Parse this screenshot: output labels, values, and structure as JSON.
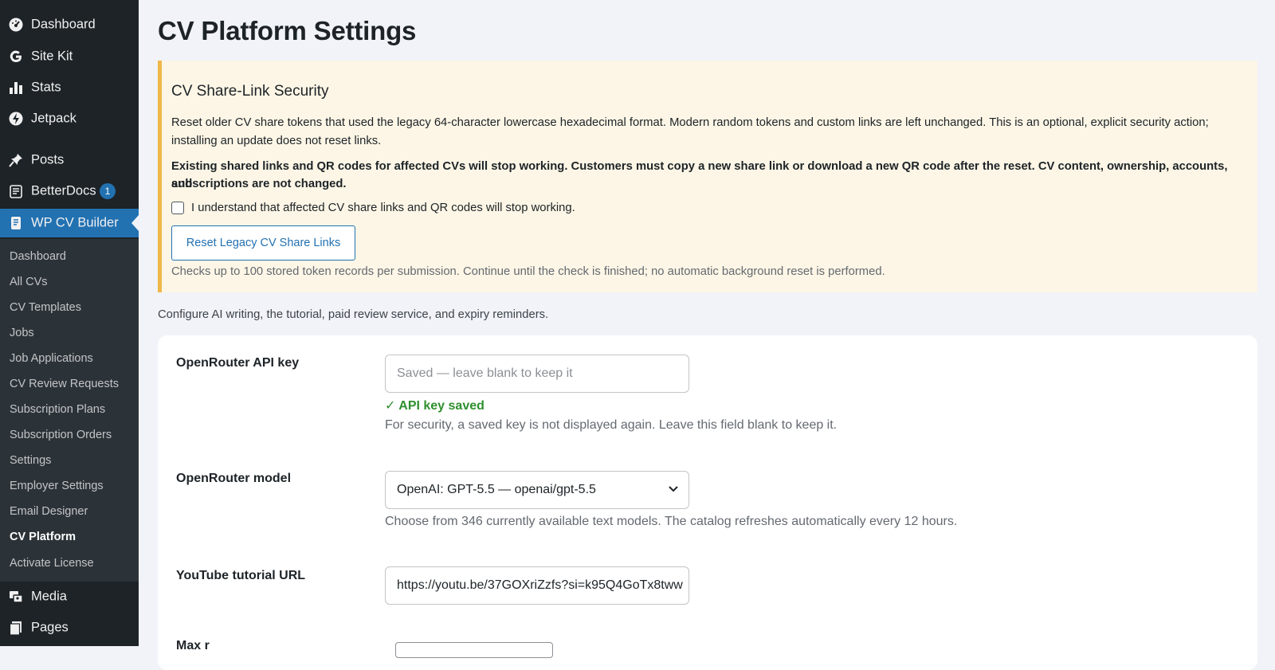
{
  "sidebar": {
    "top_items": [
      {
        "label": "Dashboard",
        "icon": "dashboard-icon"
      },
      {
        "label": "Site Kit",
        "icon": "google-g-icon"
      },
      {
        "label": "Stats",
        "icon": "bar-chart-icon"
      },
      {
        "label": "Jetpack",
        "icon": "jetpack-bolt-icon"
      },
      {
        "label": "Posts",
        "icon": "pin-icon"
      },
      {
        "label": "BetterDocs",
        "icon": "docs-icon",
        "badge": "1"
      },
      {
        "label": "WP CV Builder",
        "icon": "cv-builder-icon"
      }
    ],
    "submenu": [
      "Dashboard",
      "All CVs",
      "CV Templates",
      "Jobs",
      "Job Applications",
      "CV Review Requests",
      "Subscription Plans",
      "Subscription Orders",
      "Settings",
      "Employer Settings",
      "Email Designer",
      "CV Platform",
      "Activate License"
    ],
    "current_submenu": "CV Platform",
    "bottom_items": [
      {
        "label": "Media",
        "icon": "media-icon"
      },
      {
        "label": "Pages",
        "icon": "pages-icon"
      }
    ]
  },
  "page": {
    "title": "CV Platform Settings"
  },
  "notice": {
    "title": "CV Share-Link Security",
    "line1": "Reset older CV share tokens that used the legacy 64-character lowercase hexadecimal format. Modern random tokens and custom links are left unchanged. This is an optional, explicit security action;",
    "line2": "installing an update does not reset links.",
    "warning1": "Existing shared links and QR codes for affected CVs will stop working. Customers must copy a new share link or download a new QR code after the reset. CV content, ownership, accounts, and",
    "warning2": "subscriptions are not changed.",
    "checkbox_label": "I understand that affected CV share links and QR codes will stop working.",
    "button_label": "Reset Legacy CV Share Links",
    "hint": "Checks up to 100 stored token records per submission. Continue until the check is finished; no automatic background reset is performed."
  },
  "intro": "Configure AI writing, the tutorial, paid review service, and expiry reminders.",
  "settings": {
    "api_key": {
      "label": "OpenRouter API key",
      "placeholder": "Saved — leave blank to keep it",
      "status": "✓ API key saved",
      "description": "For security, a saved key is not displayed again. Leave this field blank to keep it."
    },
    "model": {
      "label": "OpenRouter model",
      "selected": "OpenAI: GPT-5.5 — openai/gpt-5.5",
      "description": "Choose from 346 currently available text models. The catalog refreshes automatically every 12 hours."
    },
    "youtube": {
      "label": "YouTube tutorial URL",
      "value": "https://youtu.be/37GOXriZzfs?si=k95Q4GoTx8tww"
    },
    "next_label_partial": "Max r"
  }
}
